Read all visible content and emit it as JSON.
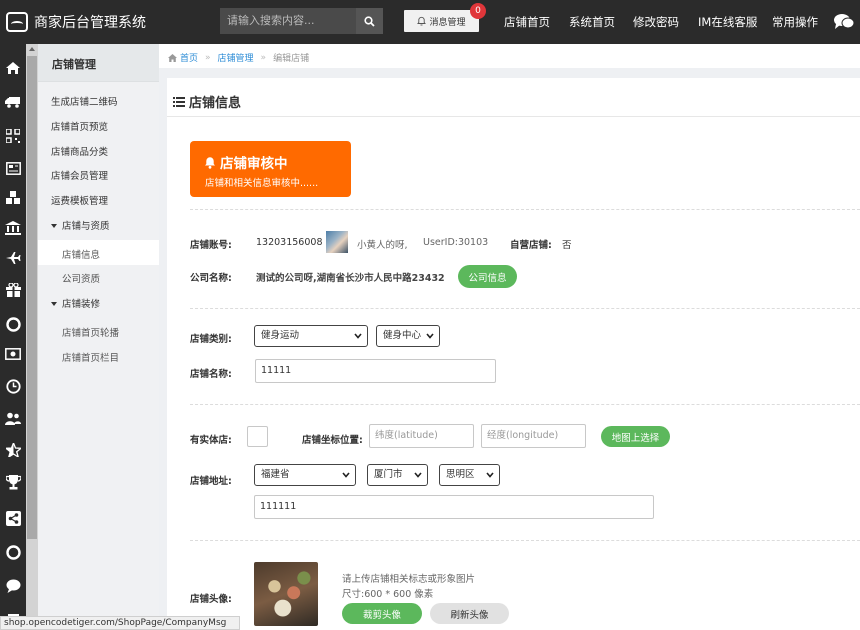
{
  "app": {
    "title": "商家后台管理系统"
  },
  "search": {
    "placeholder": "请输入搜索内容..."
  },
  "header": {
    "message_label": "消息管理",
    "message_count": "0",
    "nav": [
      "店铺首页",
      "系统首页",
      "修改密码",
      "IM在线客服",
      "常用操作"
    ]
  },
  "sidebar": {
    "title": "店铺管理",
    "items": [
      "生成店铺二维码",
      "店铺首页预览",
      "店铺商品分类",
      "店铺会员管理",
      "运费模板管理"
    ],
    "group1": {
      "label": "店铺与资质",
      "items": [
        "店铺信息",
        "公司资质"
      ]
    },
    "group2": {
      "label": "店铺装修",
      "items": [
        "店铺首页轮播",
        "店铺首页栏目"
      ]
    }
  },
  "breadcrumb": {
    "home": "首页",
    "section": "店铺管理",
    "current": "编辑店铺"
  },
  "panel": {
    "title": "店铺信息"
  },
  "notice": {
    "title": "店铺审核中",
    "subtitle": "店铺和相关信息审核中......"
  },
  "account": {
    "label": "店铺账号:",
    "value": "13203156008",
    "nickname": "小黄人的呀,",
    "userid": "UserID:30103",
    "self_label": "自营店铺:",
    "self_value": "否"
  },
  "company": {
    "label": "公司名称:",
    "value": "测试的公司呀,湖南省长沙市人民中路23432",
    "button": "公司信息"
  },
  "category": {
    "label": "店铺类别:",
    "primary": "健身运动",
    "secondary": "健身中心"
  },
  "shop_name": {
    "label": "店铺名称:",
    "value": "11111"
  },
  "physical": {
    "label": "有实体店:"
  },
  "coords": {
    "label": "店铺坐标位置:",
    "lat_placeholder": "纬度(latitude)",
    "lng_placeholder": "经度(longitude)",
    "button": "地图上选择"
  },
  "address": {
    "label": "店铺地址:",
    "province": "福建省",
    "city": "厦门市",
    "district": "思明区",
    "detail": "111111"
  },
  "avatar": {
    "label": "店铺头像:",
    "hint": "请上传店铺相关标志或形象图片",
    "size_hint": "尺寸:600 * 600 像素",
    "crop_button": "裁剪头像",
    "refresh_button": "刷新头像"
  },
  "status_url": "shop.opencodetiger.com/ShopPage/CompanyMsg",
  "colors": {
    "accent_orange": "#ff6a00",
    "button_green": "#5cb85c",
    "link_blue": "#2d8cd6",
    "topbar": "#2b2b2b"
  }
}
